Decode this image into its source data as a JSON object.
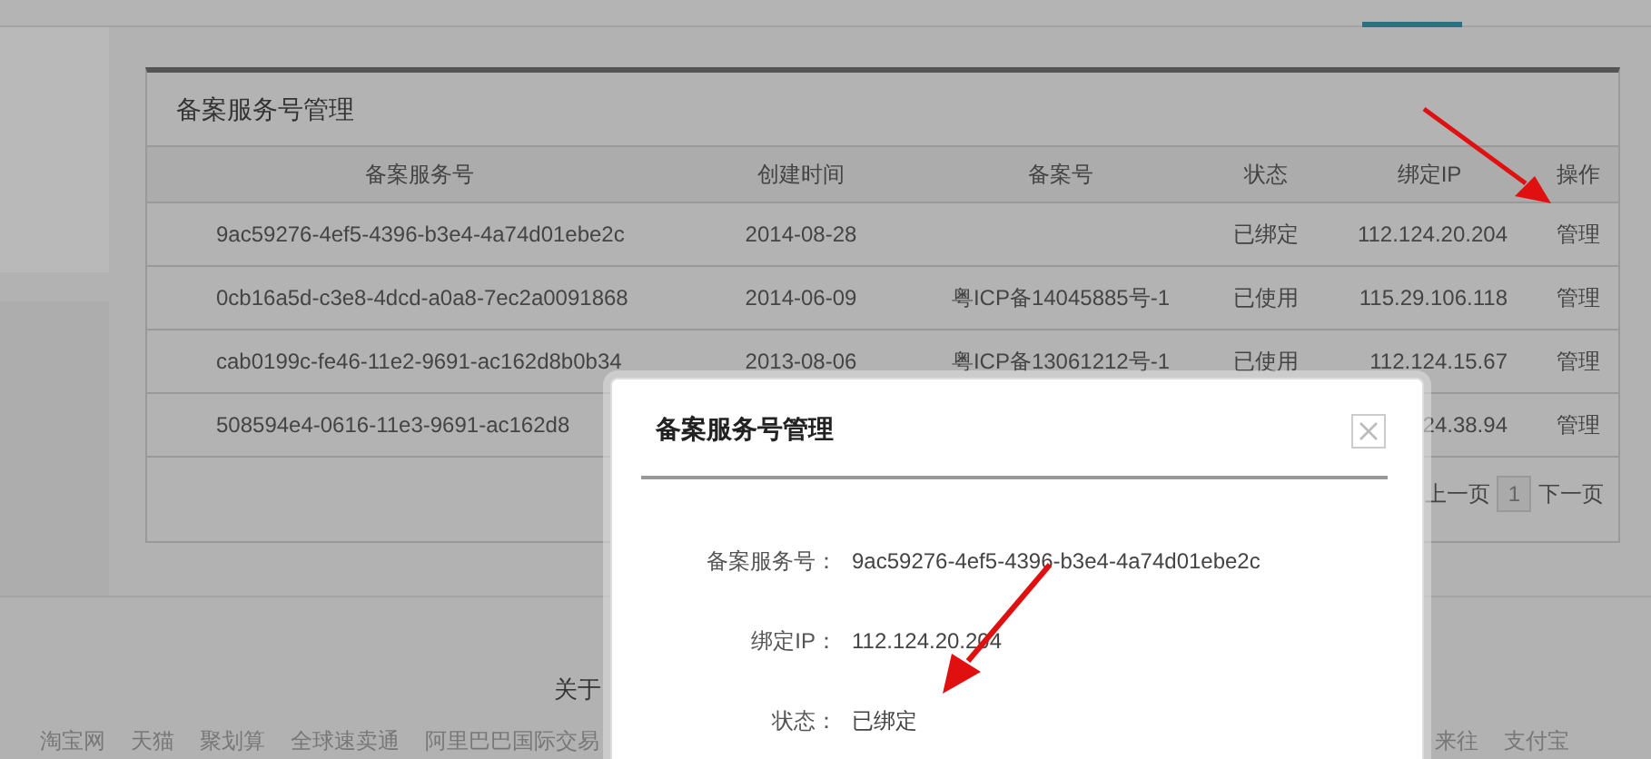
{
  "panel": {
    "title": "备案服务号管理",
    "table": {
      "columns": [
        "备案服务号",
        "创建时间",
        "备案号",
        "状态",
        "绑定IP",
        "操作"
      ],
      "rows": [
        {
          "service_no": "9ac59276-4ef5-4396-b3e4-4a74d01ebe2c",
          "created": "2014-08-28",
          "status": "已绑定",
          "ip": "112.124.20.204",
          "action": "管理"
        },
        {
          "service_no": "0cb16a5d-c3e8-4dcd-a0a8-7ec2a0091868",
          "created": "2014-06-09",
          "icp_no": "粤ICP备14045885号-1",
          "status": "已使用",
          "ip": "115.29.106.118",
          "action": "管理"
        },
        {
          "service_no": "cab0199c-fe46-11e2-9691-ac162d8b0b34",
          "created": "2013-08-06",
          "icp_no": "粤ICP备13061212号-1",
          "status": "已使用",
          "ip": "112.124.15.67",
          "action": "管理"
        },
        {
          "service_no": "508594e4-0616-11e3-9691-ac162d8",
          "ip": "24.38.94",
          "action": "管理"
        }
      ]
    },
    "pagination": {
      "prev": "上一页",
      "pages": [
        {
          "label": "1",
          "selected": true
        }
      ],
      "next": "下一页"
    }
  },
  "dialog": {
    "title": "备案服务号管理",
    "fields": [
      {
        "label": "备案服务号：",
        "value": "9ac59276-4ef5-4396-b3e4-4a74d01ebe2c"
      },
      {
        "label": "绑定IP：",
        "value": "112.124.20.204"
      },
      {
        "label": "状态：",
        "value": "已绑定"
      }
    ]
  },
  "footer": {
    "about": "关于",
    "links": [
      "淘宝网",
      "天猫",
      "聚划算",
      "全球速卖通",
      "阿里巴巴国际交易"
    ],
    "links_right": [
      "来往",
      "支付宝"
    ]
  }
}
